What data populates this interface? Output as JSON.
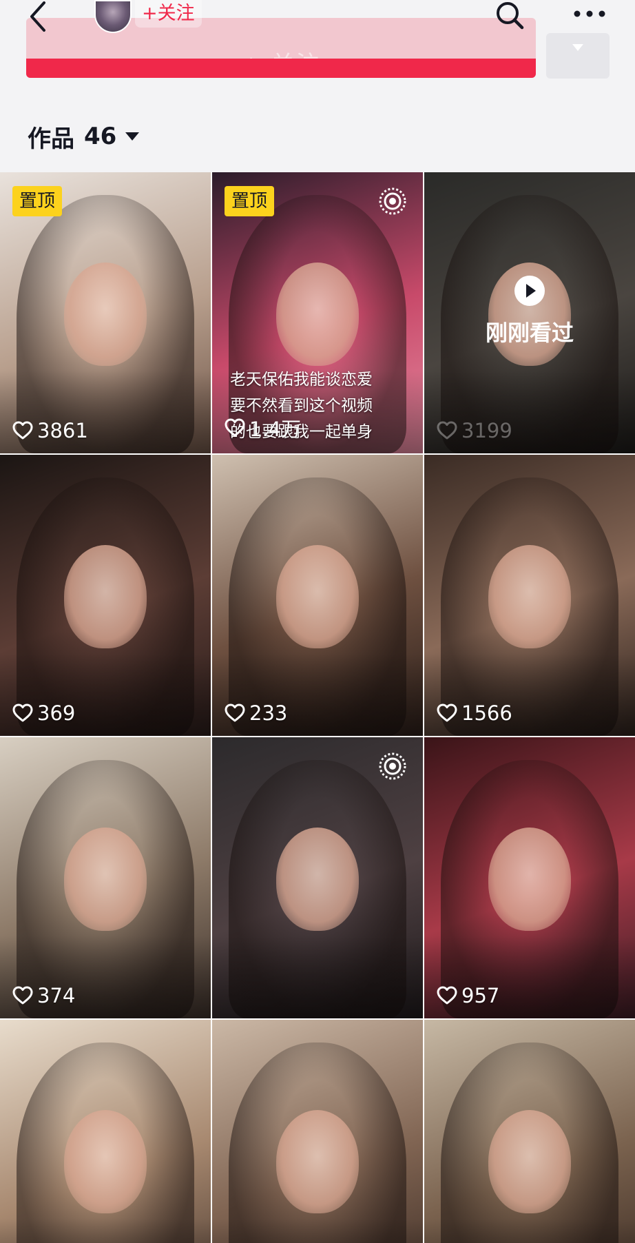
{
  "header": {
    "follow_mini_label": "+关注",
    "follow_button_label": "+ 关注",
    "works_label": "作品",
    "works_count": "46"
  },
  "colors": {
    "accent_red": "#f0284a",
    "pin_yellow": "#fcd21d",
    "background": "#f3f3f5"
  },
  "icons": {
    "back": "chevron-left-icon",
    "search": "search-icon",
    "more": "more-dots-icon",
    "caret": "caret-down-icon",
    "heart": "heart-outline-icon",
    "live": "live-ring-icon",
    "play": "play-icon"
  },
  "grid": {
    "tiles": [
      {
        "pinned_label": "置顶",
        "likes": "3861",
        "bg": [
          "#e9e2dc",
          "#b89f8d",
          "#6b5245"
        ]
      },
      {
        "pinned_label": "置顶",
        "live": true,
        "likes": "1.4万",
        "caption": [
          "老天保佑我能谈恋爱",
          "要不然看到这个视频",
          "的也要跟我一起单身"
        ],
        "bg": [
          "#2b1c2a",
          "#c84a6a",
          "#e58aa0"
        ]
      },
      {
        "watched_label": "刚刚看过",
        "likes": "3199",
        "likes_dim": true,
        "bg": [
          "#2a2a28",
          "#4a4540",
          "#1c1a18"
        ]
      },
      {
        "likes": "369",
        "bg": [
          "#1b1513",
          "#5c3d35",
          "#2a1c1a"
        ]
      },
      {
        "likes": "233",
        "bg": [
          "#cfc0b0",
          "#6e5040",
          "#2b1e19"
        ]
      },
      {
        "likes": "1566",
        "bg": [
          "#3a2b24",
          "#8a6a58",
          "#2c211c"
        ]
      },
      {
        "likes": "374",
        "bg": [
          "#d8cfc2",
          "#8d7a68",
          "#3c302a"
        ]
      },
      {
        "live": true,
        "likes": "",
        "bg": [
          "#2c2a2c",
          "#4e4042",
          "#1f1a1c"
        ]
      },
      {
        "likes": "957",
        "bg": [
          "#3a1418",
          "#a83a48",
          "#3c1c24"
        ]
      },
      {
        "likes": "",
        "bg": [
          "#e8dccc",
          "#a7886f",
          "#4c3a30"
        ]
      },
      {
        "likes": "",
        "bg": [
          "#cbb8a6",
          "#806452",
          "#3c2c24"
        ]
      },
      {
        "likes": "",
        "bg": [
          "#c6b8a4",
          "#7a624e",
          "#3a2a22"
        ]
      }
    ]
  }
}
